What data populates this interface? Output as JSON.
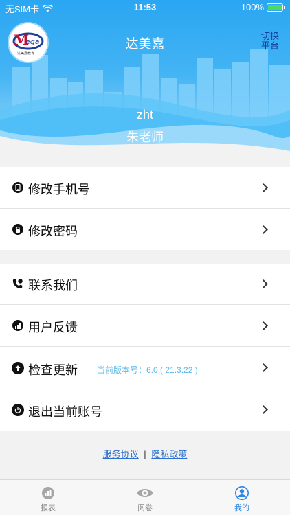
{
  "status_bar": {
    "carrier": "无SIM卡",
    "time": "11:53",
    "battery": "100%"
  },
  "header": {
    "app_title": "达美嘉",
    "switch_label": "切换平台",
    "logo_text": "ega",
    "logo_caption": "达美嘉教育",
    "user_name": "zht",
    "user_role": "朱老师"
  },
  "menu": {
    "items": [
      {
        "label": "修改手机号",
        "icon": "phone-icon"
      },
      {
        "label": "修改密码",
        "icon": "lock-icon"
      },
      {
        "label": "联系我们",
        "icon": "call-icon"
      },
      {
        "label": "用户反馈",
        "icon": "chart-icon"
      },
      {
        "label": "检查更新",
        "icon": "update-icon",
        "sub": "当前版本号：6.0 ( 21.3.22 )"
      },
      {
        "label": "退出当前账号",
        "icon": "power-icon"
      }
    ]
  },
  "footer": {
    "service_link": "服务协议",
    "separator": "|",
    "privacy_link": "隐私政策"
  },
  "tabbar": {
    "tabs": [
      {
        "label": "报表",
        "icon": "report-icon"
      },
      {
        "label": "阅卷",
        "icon": "eye-icon"
      },
      {
        "label": "我的",
        "icon": "user-icon"
      }
    ],
    "active_index": 2
  },
  "colors": {
    "accent": "#2b86e4",
    "header_blue": "#2aa6f2",
    "version_text": "#5cb8e6"
  }
}
